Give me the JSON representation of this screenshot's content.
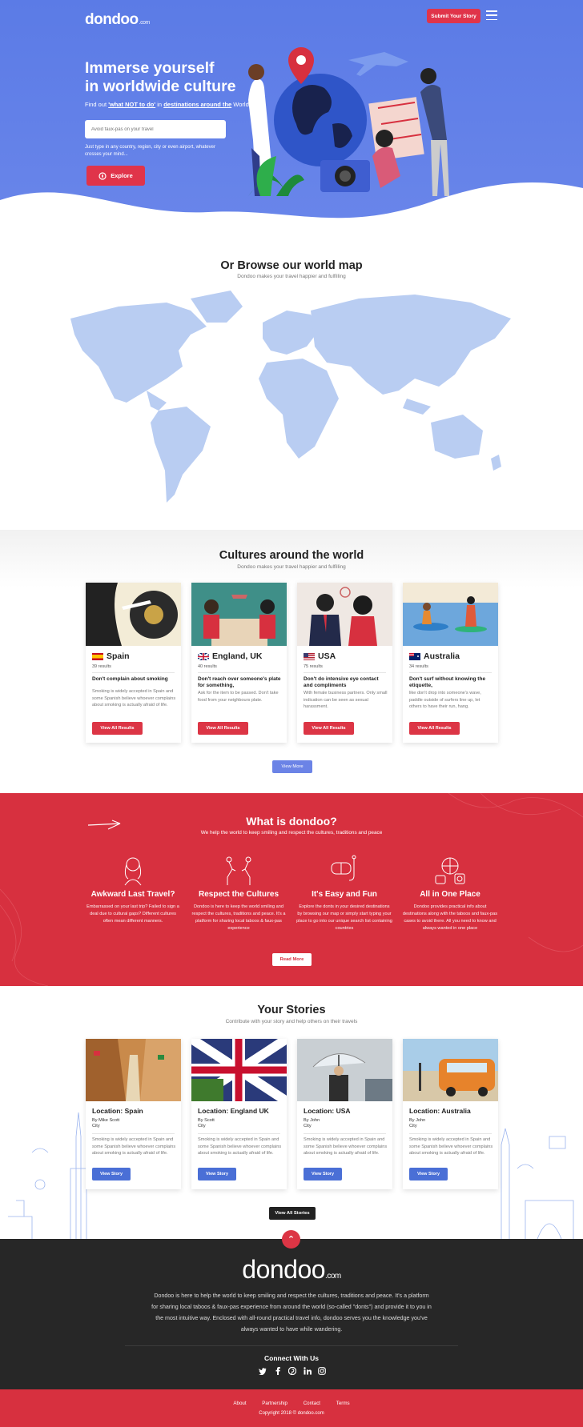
{
  "header": {
    "logo": "dondoo",
    "logo_suffix": ".com",
    "submit_label": "Submit Your Story"
  },
  "hero": {
    "title_line1": "Immerse yourself",
    "title_line2": "in worldwide culture",
    "subtitle_prefix": "Find out ",
    "subtitle_link1": "'what NOT to do'",
    "subtitle_mid": " in ",
    "subtitle_link2": "destinations around the",
    "subtitle_suffix": " World",
    "search_placeholder": "Avoid faux-pas on your travel",
    "hint": "Just type in any country, region, city or even airport, whatever crosses your mind...",
    "explore_label": "Explore"
  },
  "map_section": {
    "title": "Or Browse our world map",
    "subtitle": "Dondoo makes your travel happier and fulfilling"
  },
  "cultures": {
    "title": "Cultures around the world",
    "subtitle": "Dondoo makes your travel happier and fulfilling",
    "view_all_label": "View All Results",
    "view_more_label": "View More",
    "cards": [
      {
        "country": "Spain",
        "results": "39 results",
        "headline": "Don't complain about smoking",
        "desc": "Smoking is widely accepted in Spain and some Spanish believe whoever complains about smoking is actually afraid of life."
      },
      {
        "country": "England, UK",
        "results": "40 results",
        "headline": "Don't reach over someone's plate for something,",
        "desc": "Ask for the item to be passed. Don't take food from your neighbours plate."
      },
      {
        "country": "USA",
        "results": "75 results",
        "headline": "Don't do intensive eye contact and compliments",
        "desc": "With female business partners. Only small indication can be seen as sexual harassment."
      },
      {
        "country": "Australia",
        "results": "34 results",
        "headline": "Don't surf without knowing the etiquette,",
        "desc": "like don't drop into someone's wave, paddle outside of surfers line up, let others to have their run, hang."
      }
    ]
  },
  "what": {
    "title": "What is dondoo?",
    "subtitle": "We help the world to keep smiling and respect the cultures, traditions and peace",
    "read_more": "Read More",
    "features": [
      {
        "title": "Awkward Last Travel?",
        "desc": "Embarrassed on your last trip? Failed to sign a deal due to cultural gaps? Different cultures often mean different manners."
      },
      {
        "title": "Respect the Cultures",
        "desc": "Dondoo is here to keep the world smiling and respect the cultures, traditions and peace. It's a platform for sharing local taboos & faux-pas experience"
      },
      {
        "title": "It's Easy and Fun",
        "desc": "Explore the donts in your desired destinations by browsing our map or simply start typing your place to go into our unique search list containing countries"
      },
      {
        "title": "All in One Place",
        "desc": "Dondoo provides practical info about destinations along with the taboos and faux-pas cases to avoid there. All you need to know and always wanted in one place"
      }
    ]
  },
  "stories": {
    "title": "Your Stories",
    "subtitle": "Contribute with your story and help others on their travels",
    "view_story": "View Story",
    "view_all": "View All Stories",
    "cards": [
      {
        "location": "Location: Spain",
        "by": "By Mike Scott",
        "city": "City",
        "desc": "Smoking is widely accepted in Spain and some Spanish believe whoever complains about smoking is actually afraid of life."
      },
      {
        "location": "Location: England UK",
        "by": "By Scott",
        "city": "City",
        "desc": "Smoking is widely accepted in Spain and some Spanish believe whoever complains about smoking is actually afraid of life."
      },
      {
        "location": "Location: USA",
        "by": "By John",
        "city": "City",
        "desc": "Smoking is widely accepted in Spain and some Spanish believe whoever complains about smoking is actually afraid of life."
      },
      {
        "location": "Location: Australia",
        "by": "By John",
        "city": "City",
        "desc": "Smoking is widely accepted in Spain and some Spanish believe whoever complains about smoking is actually afraid of life."
      }
    ]
  },
  "footer": {
    "logo": "dondoo",
    "logo_suffix": ".com",
    "description": "Dondoo is here to help the world to keep smiling and respect the cultures, traditions and peace. It's a platform for sharing local taboos & faux-pas experience from around the world (so-called \"donts\") and provide it to you in the most intuitive way. Enclosed with all-round practical travel info, dondoo serves you the knowledge you've always wanted to have while wandering.",
    "connect": "Connect With Us",
    "socials": [
      "twitter-icon",
      "facebook-icon",
      "pinterest-icon",
      "linkedin-icon",
      "instagram-icon"
    ],
    "links": [
      "About",
      "Partnership",
      "Contact",
      "Terms"
    ],
    "copyright": "Copyright 2018 © dondoo.com"
  },
  "colors": {
    "primary_blue": "#5b7be6",
    "accent_red": "#d7303f",
    "footer_dark": "#272727",
    "map_blue": "#b9cdf2"
  }
}
